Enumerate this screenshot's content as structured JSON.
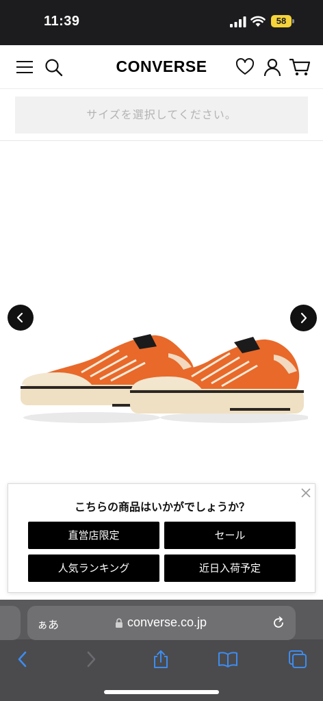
{
  "status_bar": {
    "time": "11:39",
    "battery": "58"
  },
  "header": {
    "logo_text": "CONVERSE",
    "icons": [
      "menu-icon",
      "search-icon",
      "heart-icon",
      "account-icon",
      "cart-icon"
    ]
  },
  "size_selector": {
    "placeholder": "サイズを選択してください。"
  },
  "gallery": {
    "prev": "‹",
    "next": "›"
  },
  "popup": {
    "title": "こちらの商品はいかがでしょうか？",
    "buttons": [
      "直営店限定",
      "セール",
      "人気ランキング",
      "近日入荷予定"
    ]
  },
  "browser": {
    "aa": "ぁあ",
    "url": "converse.co.jp"
  },
  "colors": {
    "shoe": "#e8692a",
    "button": "#000000",
    "status_battery": "#f5d33a"
  }
}
